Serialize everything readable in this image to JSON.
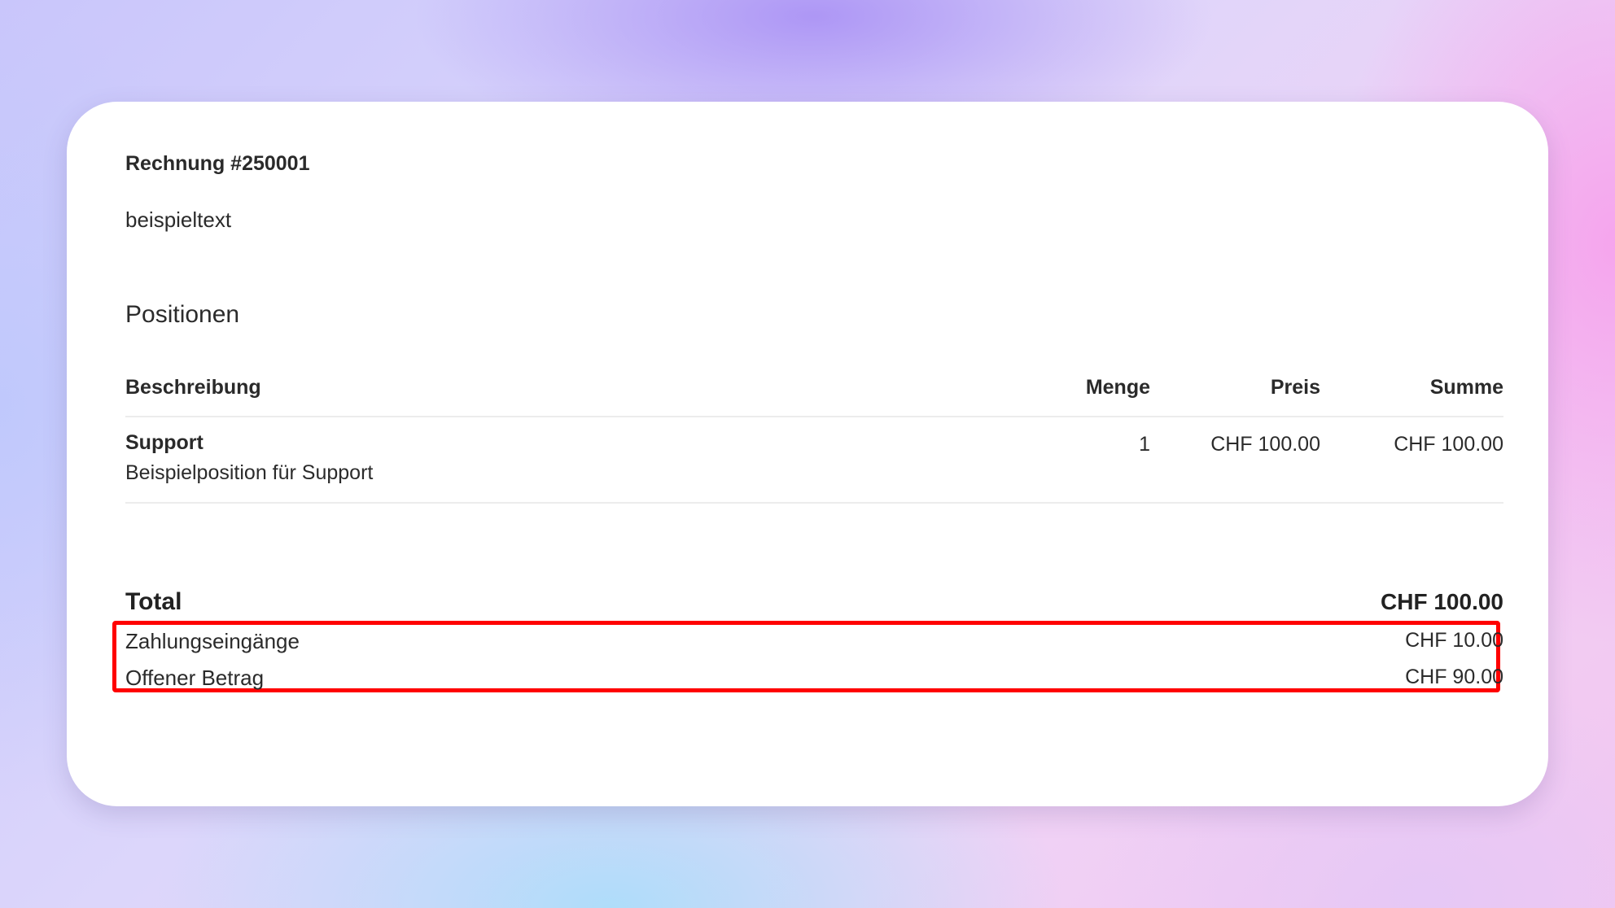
{
  "invoice": {
    "title": "Rechnung #250001",
    "description": "beispieltext"
  },
  "positions": {
    "section_title": "Positionen",
    "columns": {
      "description": "Beschreibung",
      "quantity": "Menge",
      "price": "Preis",
      "sum": "Summe"
    },
    "rows": [
      {
        "name": "Support",
        "detail": "Beispielposition für Support",
        "quantity": "1",
        "price": "CHF 100.00",
        "sum": "CHF 100.00"
      }
    ]
  },
  "summary": {
    "total_label": "Total",
    "total_value": "CHF 100.00",
    "payments_label": "Zahlungseingänge",
    "payments_value": "CHF 10.00",
    "open_label": "Offener Betrag",
    "open_value": "CHF 90.00"
  },
  "colors": {
    "highlight": "#ff0000"
  }
}
